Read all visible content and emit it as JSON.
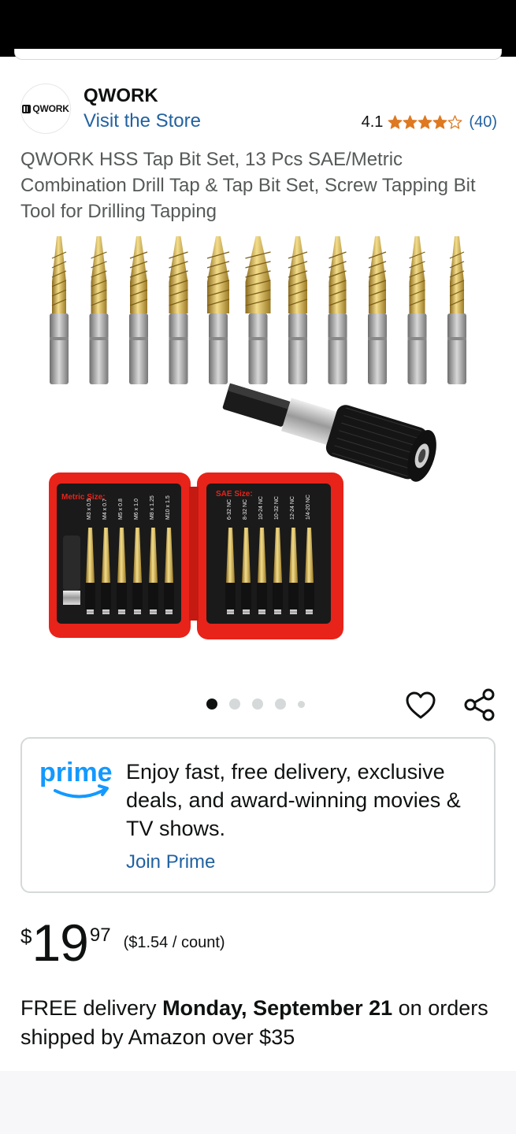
{
  "brand": {
    "logo_text": "QWORK",
    "name": "QWORK",
    "visit_store": "Visit the Store"
  },
  "rating": {
    "value": "4.1",
    "stars": 4.1,
    "count": "(40)",
    "star_color": "#de7921"
  },
  "product": {
    "title": "QWORK HSS Tap Bit Set, 13 Pcs SAE/Metric Combination Drill Tap & Tap Bit Set, Screw Tapping Bit Tool for Drilling Tapping",
    "image_labels": {
      "metric": "Metric Size:",
      "sae": "SAE Size:",
      "metric_sizes": [
        "M3 x 0.5",
        "M4 x 0.7",
        "M5 x 0.8",
        "M6 x 1.0",
        "M8 x 1.25",
        "M10 x 1.5"
      ],
      "sae_sizes": [
        "6-32 NC",
        "8-32 NC",
        "10-24 NC",
        "10-32 NC",
        "12-24 NC",
        "1/4-20 NC"
      ]
    }
  },
  "carousel": {
    "total": 5,
    "active_index": 0
  },
  "actions": {
    "heart_icon": "heart-icon",
    "share_icon": "share-icon"
  },
  "prime": {
    "logo_text": "prime",
    "text": "Enjoy fast, free delivery, exclusive deals, and award-winning movies & TV shows.",
    "join": "Join Prime",
    "brand_color": "#1399ff"
  },
  "price": {
    "symbol": "$",
    "whole": "19",
    "fraction": "97",
    "unit": "($1.54 / count)"
  },
  "delivery": {
    "prefix": "FREE delivery ",
    "date": "Monday, September 21",
    "suffix": " on orders shipped by Amazon over $35"
  },
  "colors": {
    "link": "#2162a1",
    "title_gray": "#565959",
    "case_red": "#e8231a",
    "gold": "#c9a43a"
  }
}
